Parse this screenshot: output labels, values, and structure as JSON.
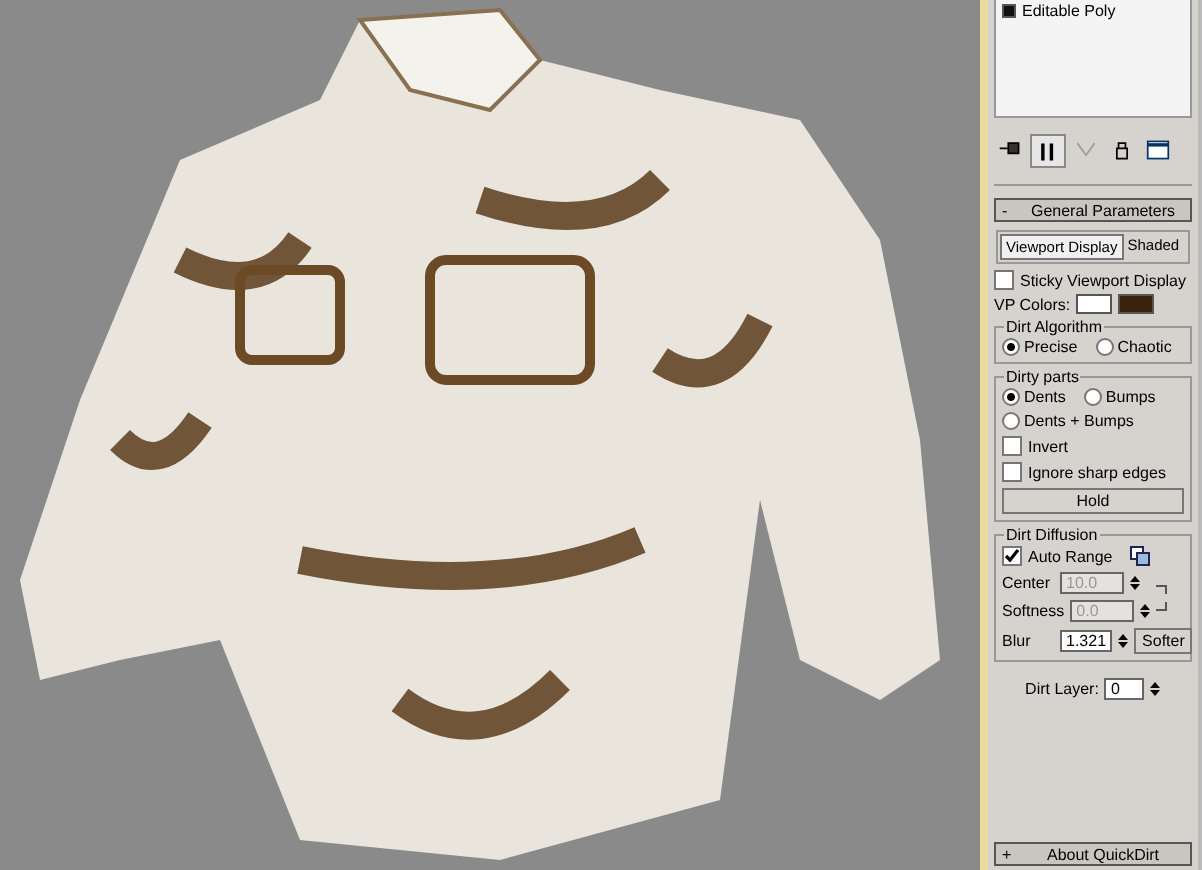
{
  "modifier_stack": [
    {
      "label": "Editable Poly"
    }
  ],
  "stack_toolbar": [
    {
      "kind": "pin",
      "pressed": false
    },
    {
      "kind": "show-end",
      "pressed": true
    },
    {
      "kind": "unique",
      "pressed": false
    },
    {
      "kind": "remove",
      "pressed": false
    },
    {
      "kind": "configure",
      "pressed": false
    }
  ],
  "general_parameters": {
    "title": "General Parameters",
    "toggle": "-",
    "tabs": [
      {
        "label": "Viewport Display",
        "selected": true
      },
      {
        "label": "Shaded",
        "selected": false
      }
    ],
    "sticky": {
      "label": "Sticky Viewport Display",
      "checked": false
    },
    "vp_colors": {
      "label": "VP Colors:",
      "swatches": [
        {
          "color": "#ffffff"
        },
        {
          "color": "#3a230e"
        }
      ]
    },
    "dirt_algorithm": {
      "title": "Dirt Algorithm",
      "options": [
        {
          "label": "Precise",
          "selected": true
        },
        {
          "label": "Chaotic",
          "selected": false
        }
      ]
    },
    "dirty_parts": {
      "title": "Dirty parts",
      "options": [
        {
          "label": "Dents",
          "selected": true
        },
        {
          "label": "Bumps",
          "selected": false
        },
        {
          "label": "Dents + Bumps",
          "selected": false
        }
      ],
      "checks": [
        {
          "label": "Invert",
          "checked": false
        },
        {
          "label": "Ignore sharp edges",
          "checked": false
        }
      ],
      "button": "Hold"
    },
    "dirt_diffusion": {
      "title": "Dirt Diffusion",
      "auto_range": {
        "label": "Auto Range",
        "checked": true
      },
      "spinners": [
        {
          "label": "Center",
          "value": "10.0",
          "disabled": true
        },
        {
          "label": "Softness",
          "value": "0.0",
          "disabled": true
        }
      ],
      "blur": {
        "label": "Blur",
        "value": "1.321",
        "button": "Softer"
      }
    },
    "dirt_layer": {
      "label": "Dirt Layer:",
      "value": "0"
    }
  },
  "rollouts": [
    {
      "title": "About QuickDirt",
      "toggle": "+"
    }
  ]
}
